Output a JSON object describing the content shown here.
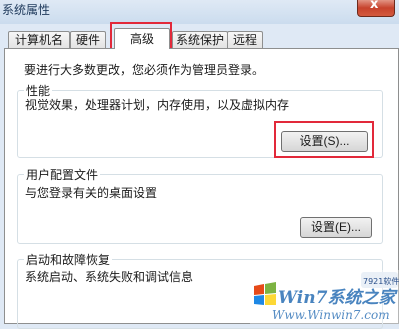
{
  "window": {
    "title": "系统属性",
    "close_label": "x"
  },
  "tabs": [
    {
      "label": "计算机名"
    },
    {
      "label": "硬件"
    },
    {
      "label": "高级"
    },
    {
      "label": "系统保护"
    },
    {
      "label": "远程"
    }
  ],
  "admin_note": "要进行大多数更改，您必须作为管理员登录。",
  "performance": {
    "title": "性能",
    "description": "视觉效果，处理器计划，内存使用，以及虚拟内存",
    "button": "设置(S)..."
  },
  "user_profiles": {
    "title": "用户配置文件",
    "description": "与您登录有关的桌面设置",
    "button": "设置(E)..."
  },
  "startup_recovery": {
    "title": "启动和故障恢复",
    "description": "系统启动、系统失败和调试信息"
  },
  "watermark": {
    "brand": "Win7系统之家",
    "url": "Www.Winwin7.com",
    "badge": "7921软件园"
  },
  "colors": {
    "highlight": "#e2293a",
    "title_text": "#1e395b"
  }
}
